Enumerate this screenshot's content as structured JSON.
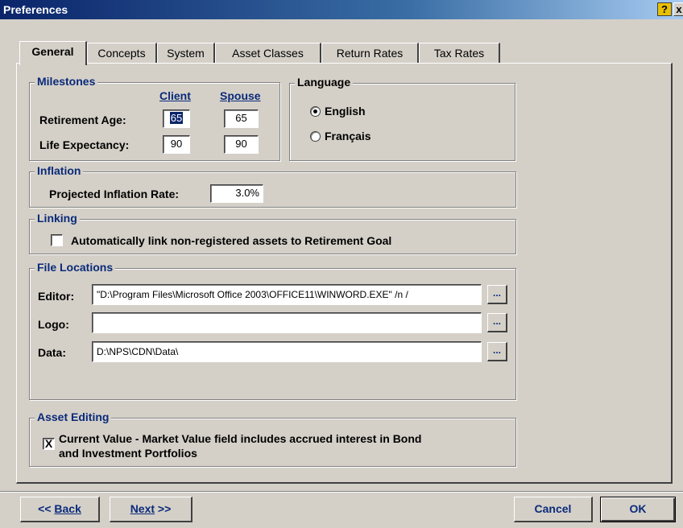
{
  "window": {
    "title": "Preferences",
    "help_icon": "?",
    "close_icon": "x"
  },
  "tabs": [
    {
      "label": "General",
      "active": true
    },
    {
      "label": "Concepts"
    },
    {
      "label": "System"
    },
    {
      "label": "Asset Classes"
    },
    {
      "label": "Return Rates"
    },
    {
      "label": "Tax Rates"
    }
  ],
  "milestones": {
    "title": "Milestones",
    "col_client": "Client",
    "col_spouse": "Spouse",
    "retirement_label": "Retirement Age:",
    "retirement_client": "65",
    "retirement_spouse": "65",
    "life_label": "Life Expectancy:",
    "life_client": "90",
    "life_spouse": "90"
  },
  "language": {
    "title": "Language",
    "options": [
      {
        "label": "English",
        "selected": true
      },
      {
        "label": "Français",
        "selected": false
      }
    ]
  },
  "inflation": {
    "title": "Inflation",
    "rate_label": "Projected Inflation Rate:",
    "rate_value": "3.0%"
  },
  "linking": {
    "title": "Linking",
    "checkbox_label": "Automatically link non-registered assets to Retirement Goal",
    "checked": false
  },
  "file_locations": {
    "title": "File Locations",
    "editor_label": "Editor:",
    "editor_value": "\"D:\\Program Files\\Microsoft Office 2003\\OFFICE11\\WINWORD.EXE\" /n /",
    "logo_label": "Logo:",
    "logo_value": "",
    "data_label": "Data:",
    "data_value": "D:\\NPS\\CDN\\Data\\",
    "browse_label": "..."
  },
  "asset_editing": {
    "title": "Asset Editing",
    "checkbox_label_line1": "Current Value - Market Value field includes accrued interest in Bond",
    "checkbox_label_line2": "and Investment Portfolios",
    "checked": true,
    "check_mark": "X"
  },
  "buttons": {
    "back_prefix": "<< ",
    "back": "Back",
    "next": "Next",
    "next_suffix": " >>",
    "cancel": "Cancel",
    "ok": "OK"
  },
  "colors": {
    "accent": "#0a2a7a",
    "face": "#d4d0c8",
    "title_start": "#0a246a"
  }
}
